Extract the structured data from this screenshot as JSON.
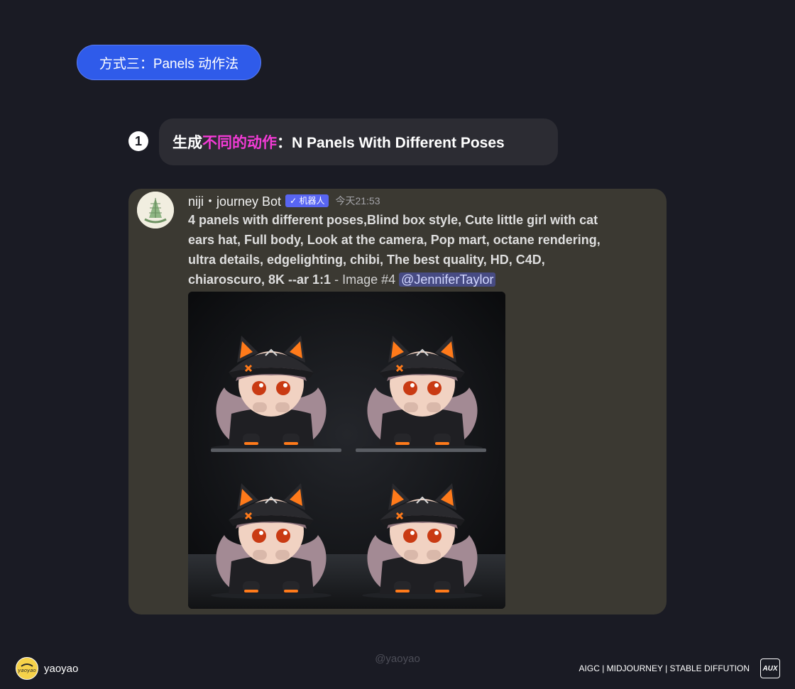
{
  "section_pill": "方式三：Panels 动作法",
  "step": {
    "number": "1",
    "heading_prefix": "生成",
    "heading_highlight": "不同的动作",
    "heading_suffix": "：N Panels With Different Poses"
  },
  "message": {
    "username": "niji・journey Bot",
    "badge": "✓ 机器人",
    "timestamp": "今天21:53",
    "prompt_bold": "4 panels with different poses,Blind box style, Cute little girl with cat ears hat, Full body, Look at the camera, Pop mart, octane rendering, ultra details, edgelighting, chibi, The best quality, HD, C4D, chiaroscuro, 8K --ar 1:1",
    "prompt_suffix": " - Image #4 ",
    "mention": "@JenniferTaylor",
    "image_description": "2x2 grid of chibi blind-box figures: girl with black cat-ear cap, orange ears, long pink-brown hair, black hoodie",
    "colors": {
      "badge": "#5865f2",
      "card": "#3b3932",
      "highlight": "#f33bd6",
      "accent_orange": "#ff7a1a"
    }
  },
  "footer": {
    "author": "yaoyao",
    "logo_text": "yaoyao",
    "watermark": "@yaoyao",
    "tags": "AIGC | MIDJOURNEY | STABLE DIFFUTION",
    "aux_logo": "AUX"
  }
}
